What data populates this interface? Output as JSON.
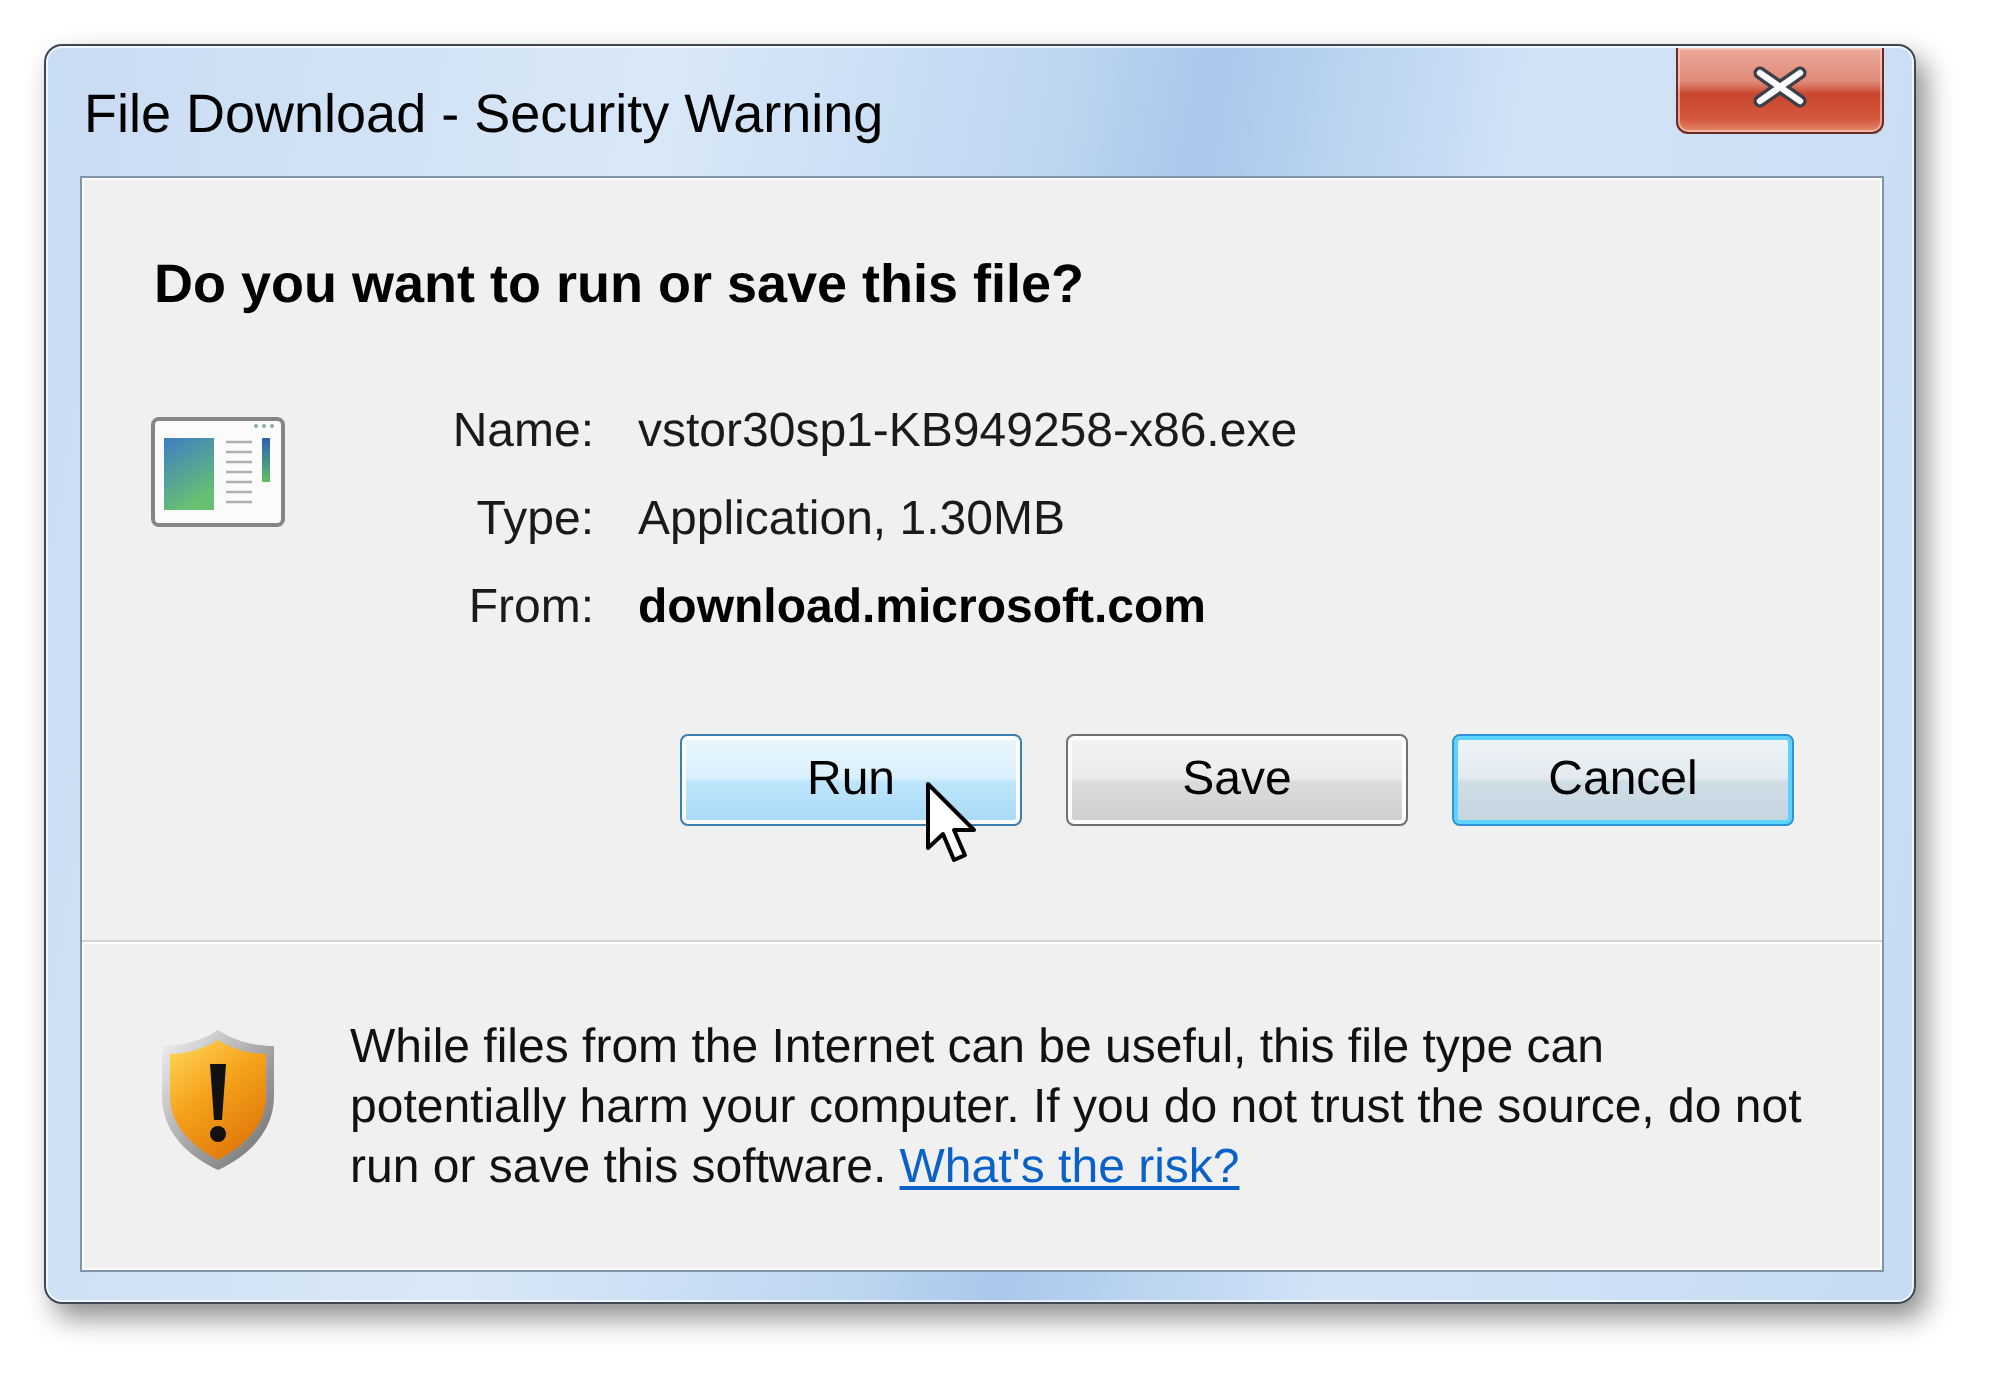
{
  "window": {
    "title": "File Download - Security Warning"
  },
  "prompt": {
    "heading": "Do you want to run or save this file?"
  },
  "file_details": [
    {
      "label": "Name:",
      "value": "vstor30sp1-KB949258-x86.exe",
      "emphasized": false
    },
    {
      "label": "Type:",
      "value": "Application, 1.30MB",
      "emphasized": false
    },
    {
      "label": "From:",
      "value": "download.microsoft.com",
      "emphasized": true
    }
  ],
  "buttons": [
    {
      "label": "Run",
      "hovered": true,
      "focused": false
    },
    {
      "label": "Save",
      "hovered": false,
      "focused": false
    },
    {
      "label": "Cancel",
      "hovered": false,
      "focused": true
    }
  ],
  "warning": {
    "text": "While files from the Internet can be useful, this file type can potentially harm your computer. If you do not trust the source, do not run or save this software.",
    "link": "What's the risk?"
  }
}
